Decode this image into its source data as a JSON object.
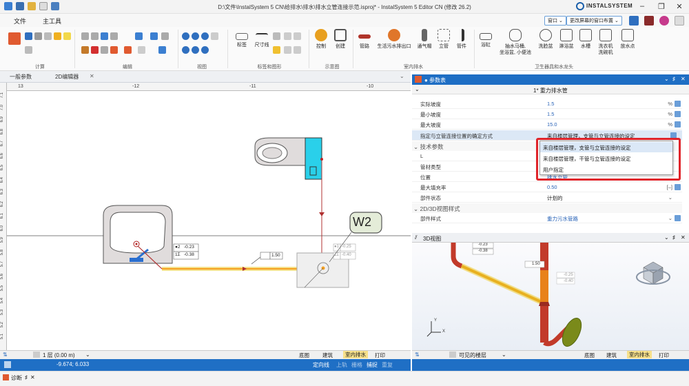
{
  "window": {
    "title": "D:\\文件\\InstalSystem 5 CN\\给排水\\排水\\排水立管连接示范.isproj* - InstalSystem 5 Editor CN (修改 26.2)",
    "brand": "INSTALSYSTEM",
    "min": "–",
    "max": "❐",
    "close": "✕"
  },
  "ribbon_tabs": [
    "文件",
    "主工具"
  ],
  "ribbon_right": {
    "window_btn": "窗口 ⌄",
    "layout_btn": "更改屏幕的窗口布置 ⌄"
  },
  "ribbon_groups": [
    "计算",
    "编辑",
    "视图",
    "标签和图形",
    "示意图",
    "室内排水",
    "卫生器具和水龙头"
  ],
  "ribbon_buttons": {
    "labels": [
      "标签",
      "尺寸线"
    ],
    "control": "控制",
    "create": "创建",
    "pipes": "管路",
    "drain_outlet": "生活污水排出口",
    "vent_cap": "通气帽",
    "riser": "立管",
    "fittings": "管件",
    "urinal": "浴缸",
    "toilet": "抽水马桶,\n坐浴盆, 小便池",
    "washbasin": "洗脸盆",
    "shower": "淋浴盆",
    "sink": "水槽",
    "washer": "洗衣机\n洗碗机",
    "tap": "放水点"
  },
  "editor": {
    "tab1": "一般参数",
    "tab2": "2D编辑器",
    "ruler_h": [
      "13",
      "-12",
      "-11",
      "-10"
    ],
    "ruler_v": [
      "7.1",
      "7.0",
      "6.9",
      "6.8",
      "6.7",
      "6.6",
      "6.5",
      "6.4",
      "6.3",
      "6.2",
      "6.1",
      "6.0",
      "5.9",
      "5.8",
      "5.7",
      "5.6",
      "5.5",
      "5.4",
      "5.3",
      "5.2",
      "5.1"
    ],
    "w2_label": "W2",
    "dim_a1": "●2",
    "dim_a1v": "-0.23",
    "dim_a2": "1Σ",
    "dim_a2v": "-0.38",
    "dim_b1": "●1",
    "dim_b1v": "-0.25",
    "dim_b2": "1Σ",
    "dim_b2v": "-0.40",
    "slope": "1.50",
    "floor": "1 层 (0.00 m)",
    "layers": [
      "底图",
      "建筑",
      "室内排水",
      "打印"
    ],
    "coords": "-9.674; 6.033",
    "status_items": [
      "定向线",
      "上轨",
      "栅格",
      "捕捉",
      "重复"
    ]
  },
  "params": {
    "title": "● 参数表",
    "subtitle": "1* 重力排水管",
    "rows": [
      {
        "k": "实际坡度",
        "v": "1.5",
        "u": "%"
      },
      {
        "k": "最小坡度",
        "v": "1.5",
        "u": "%"
      },
      {
        "k": "最大坡度",
        "v": "15.0",
        "u": "%"
      },
      {
        "k": "指定与立管连接位置的确定方式",
        "v": "来自楼层管理，支管与立管连接的设定",
        "u": ""
      }
    ],
    "section1": "技术参数",
    "rows2": [
      {
        "k": "L",
        "v": "",
        "u": ""
      },
      {
        "k": "管材类型",
        "v": "",
        "u": ""
      },
      {
        "k": "位置",
        "v": "排水立管",
        "u": ""
      },
      {
        "k": "最大填充率",
        "v": "0.50",
        "u": "[–]"
      },
      {
        "k": "部件状态",
        "v": "计划的",
        "u": ""
      }
    ],
    "section2": "2D/3D视图样式",
    "rows3": [
      {
        "k": "部件样式",
        "v": "重力污水管路",
        "u": ""
      }
    ],
    "dropdown": [
      "来自楼层管理，支管与立管连接的设定",
      "来自楼层管理，干管与立管连接的设定",
      "用户指定"
    ]
  },
  "view3d": {
    "title": "3D视图",
    "dim_a1v": "-0.23",
    "dim_a2v": "-0.38",
    "slope": "1.50",
    "dim_b1v": "-0.25",
    "dim_b2v": "-0.40",
    "axis_x": "X",
    "axis_y": "Y",
    "visible_floors": "可见的楼层",
    "layers": [
      "底图",
      "建筑",
      "室内排水",
      "打印"
    ]
  },
  "bottom": {
    "diagnostics": "诊断",
    "pin": "♯",
    "close": "✕"
  }
}
